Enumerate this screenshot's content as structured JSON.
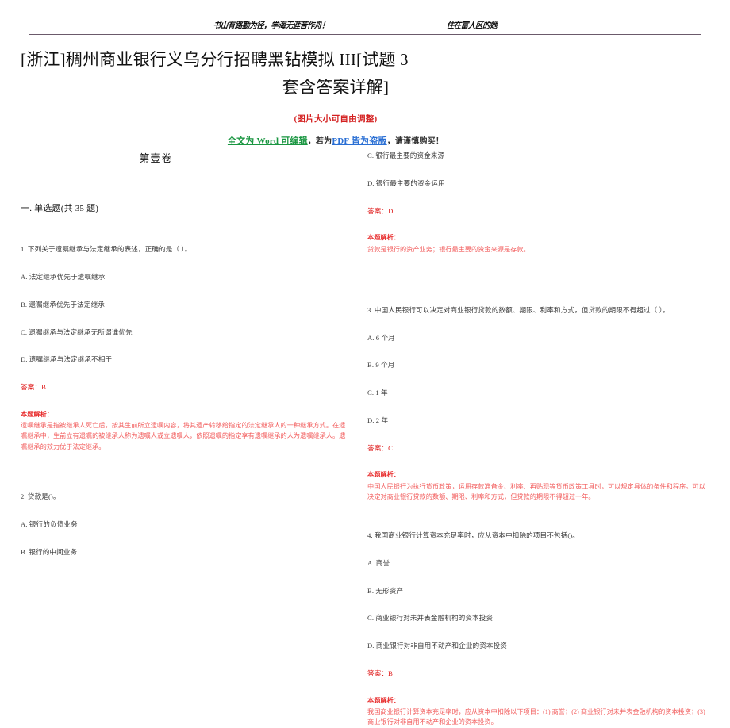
{
  "header": {
    "motto_pre": "书",
    "motto": "书山有路勤为径，学海无涯苦作舟！",
    "motto_left": "书山有路",
    "motto_accent1": "勤",
    "motto_mid": "为径，学海",
    "motto_accent2": "无涯",
    "motto_end": "苦作舟！",
    "right_note": "住在富人区的她"
  },
  "title": {
    "line1": "[浙江]稠州商业银行义乌分行招聘黑钻模拟 III[试题 3",
    "line2": "套含答案详解]"
  },
  "notice": {
    "size_note": "(图片大小可自由调整)",
    "word_part": "全文为 Word 可编辑",
    "sep1": "，若为",
    "pdf_part": "PDF 皆为盗版",
    "sep2": "，请谨慎购买！"
  },
  "body": {
    "volume_label": "第壹卷",
    "section_label": "一. 单选题(共 35 题)"
  },
  "questions": [
    {
      "stem": "1. 下列关于遗嘱继承与法定继承的表述，正确的是（    ）。",
      "options": [
        "A. 法定继承优先于遗嘱继承",
        "B. 遗嘱继承优先于法定继承",
        "C. 遗嘱继承与法定继承无所谓谁优先",
        "D. 遗嘱继承与法定继承不相干"
      ],
      "answer": "答案：B",
      "analysis_label": "本题解析：",
      "analysis_body": "遗嘱继承是指被继承人死亡后，按其生前所立遗嘱内容，将其遗产转移给指定的法定继承人的一种继承方式。在遗嘱继承中，生前立有遗嘱的被继承人称为遗嘱人或立遗嘱人，依照遗嘱的指定享有遗嘱继承的人为遗嘱继承人。遗嘱继承的效力优于法定继承。"
    },
    {
      "stem": "2. 贷款是()。",
      "options": [
        "A. 银行的负债业务",
        "B. 银行的中间业务",
        "C. 银行最主要的资金来源",
        "D. 银行最主要的资金运用"
      ],
      "answer": "答案：D",
      "analysis_label": "本题解析：",
      "analysis_body": "贷款是银行的资产业务；银行最主要的资金来源是存款。"
    },
    {
      "stem": "3. 中国人民银行可以决定对商业银行贷款的数额、期限、利率和方式，但贷款的期限不得超过（    ）。",
      "options": [
        "A. 6 个月",
        "B. 9 个月",
        "C. 1 年",
        "D. 2 年"
      ],
      "answer": "答案：C",
      "analysis_label": "本题解析：",
      "analysis_body": "中国人民银行为执行货币政策，运用存款准备金、利率、再贴现等货币政策工具时，可以规定具体的条件和程序。可以决定对商业银行贷款的数额、期限、利率和方式，但贷款的期限不得超过一年。"
    },
    {
      "stem": "4. 我国商业银行计算资本充足率时，应从资本中扣除的项目不包括()。",
      "options": [
        "A. 商誉",
        "B. 无形资产",
        "C. 商业银行对未并表金融机构的资本投资",
        "D. 商业银行对非自用不动产和企业的资本投资"
      ],
      "answer": "答案：B",
      "analysis_label": "本题解析：",
      "analysis_body": "我国商业银行计算资本充足率时，应从资本中扣除以下项目：(1) 商誉；(2) 商业银行对未并表金融机构的资本投资；(3) 商业银行对非自用不动产和企业的资本投资。"
    }
  ],
  "colors": {
    "answer_red": "#e02020",
    "analysis_red": "#f25c5c",
    "notice_green": "#1a9641",
    "notice_blue": "#2a6fd4",
    "rule": "#6b5a6b"
  }
}
